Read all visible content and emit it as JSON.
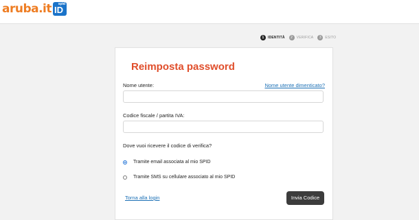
{
  "header": {
    "logo_text": "aruba.it",
    "spid_small": "spid",
    "spid_big": "ID"
  },
  "steps": [
    {
      "num": "1",
      "label": "IDENTITÀ",
      "active": true
    },
    {
      "num": "2",
      "label": "VERIFICA",
      "active": false
    },
    {
      "num": "3",
      "label": "ESITO",
      "active": false
    }
  ],
  "form": {
    "title": "Reimposta password",
    "username_label": "Nome utente:",
    "forgot_username_link": "Nome utente dimenticato?",
    "username_value": "",
    "fiscal_label": "Codice fiscale / partita IVA:",
    "fiscal_value": "",
    "delivery_question": "Dove vuoi ricevere il codice di verifica?",
    "option_email": "Tramite email associata al mio SPID",
    "option_sms": "Tramite SMS su cellulare associato al mio SPID",
    "selected_option": "email",
    "back_link": "Torna alla login",
    "submit_label": "Invia Codice"
  },
  "colors": {
    "brand_orange": "#ee7d23",
    "spid_blue": "#1a73c9",
    "title_red": "#e04e2b",
    "link_blue": "#1a6fb5",
    "button_dark": "#3c3c3c"
  }
}
